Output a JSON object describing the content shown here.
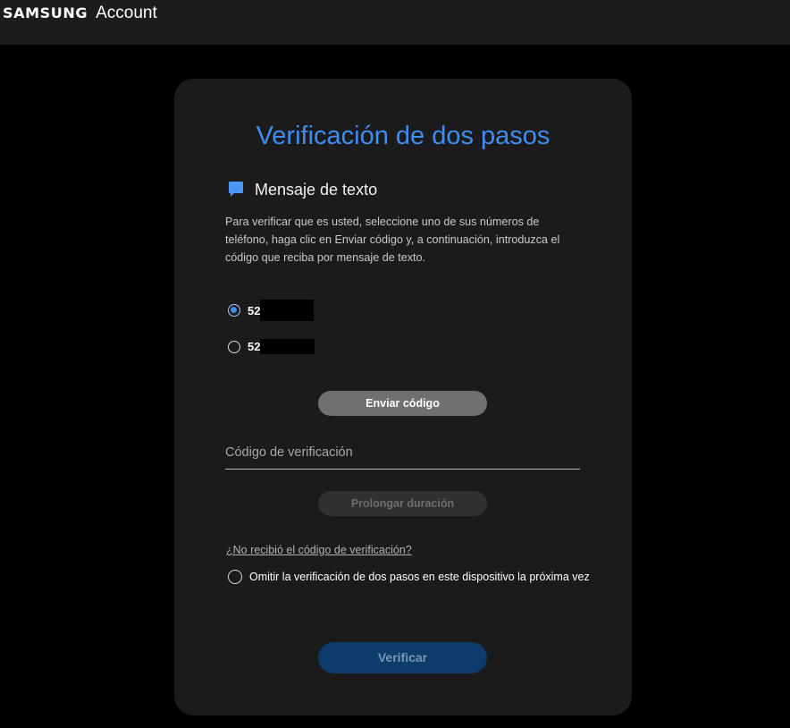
{
  "header": {
    "brand": "SAMSUNG",
    "product": "Account"
  },
  "card": {
    "title": "Verificación de dos pasos",
    "method": {
      "icon": "chat-bubble-icon",
      "label": "Mensaje de texto"
    },
    "description": "Para verificar que es usted, seleccione uno de sus números de teléfono, haga clic en Enviar código y, a continuación, introduzca el código que reciba por mensaje de texto.",
    "phones": [
      {
        "prefix": "52",
        "checked": true
      },
      {
        "prefix": "52",
        "checked": false
      }
    ],
    "send_code_label": "Enviar código",
    "code_placeholder": "Código de verificación",
    "extend_label": "Prolongar duración",
    "help_link": "¿No recibió el código de verificación?",
    "skip_label": "Omitir la verificación de dos pasos en este dispositivo la próxima vez",
    "verify_label": "Verificar"
  },
  "colors": {
    "accent": "#3e8ef1",
    "card_bg": "#1b1b1c",
    "verify_bg": "#0d3b6a"
  }
}
